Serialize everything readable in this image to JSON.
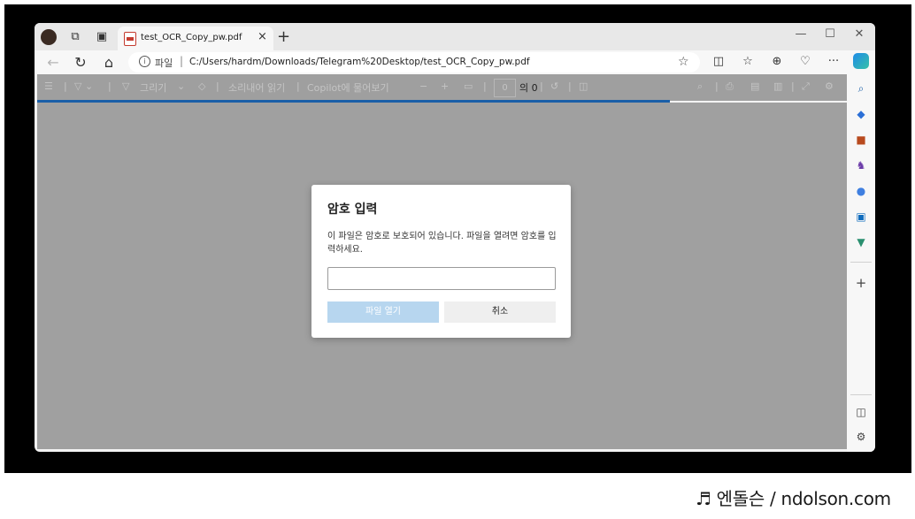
{
  "browser": {
    "tab_title": "test_OCR_Copy_pw.pdf",
    "tab_close": "×",
    "new_tab": "+",
    "minimize": "—",
    "maximize": "☐",
    "close": "✕"
  },
  "address": {
    "label": "파일",
    "separator": "|",
    "url": "C:/Users/hardm/Downloads/Telegram%20Desktop/test_OCR_Copy_pw.pdf",
    "more": "···"
  },
  "pdf_toolbar": {
    "draw": "그리기",
    "read_aloud": "소리내어 읽기",
    "copilot": "Copilot에 물어보기",
    "zoom_out": "−",
    "zoom_in": "+",
    "page_number": "0",
    "page_total": "의 0"
  },
  "dialog": {
    "title": "암호 입력",
    "message": "이 파일은 암호로 보호되어 있습니다. 파일을 열려면 암호를 입력하세요.",
    "password_value": "",
    "open_button": "파일 열기",
    "cancel_button": "취소"
  },
  "watermark": "♬ 엔돌슨 / ndolson.com",
  "colors": {
    "progress": "#1a5fa8",
    "open_button_bg": "#b7d6ef",
    "viewer_bg": "#a0a0a0"
  }
}
